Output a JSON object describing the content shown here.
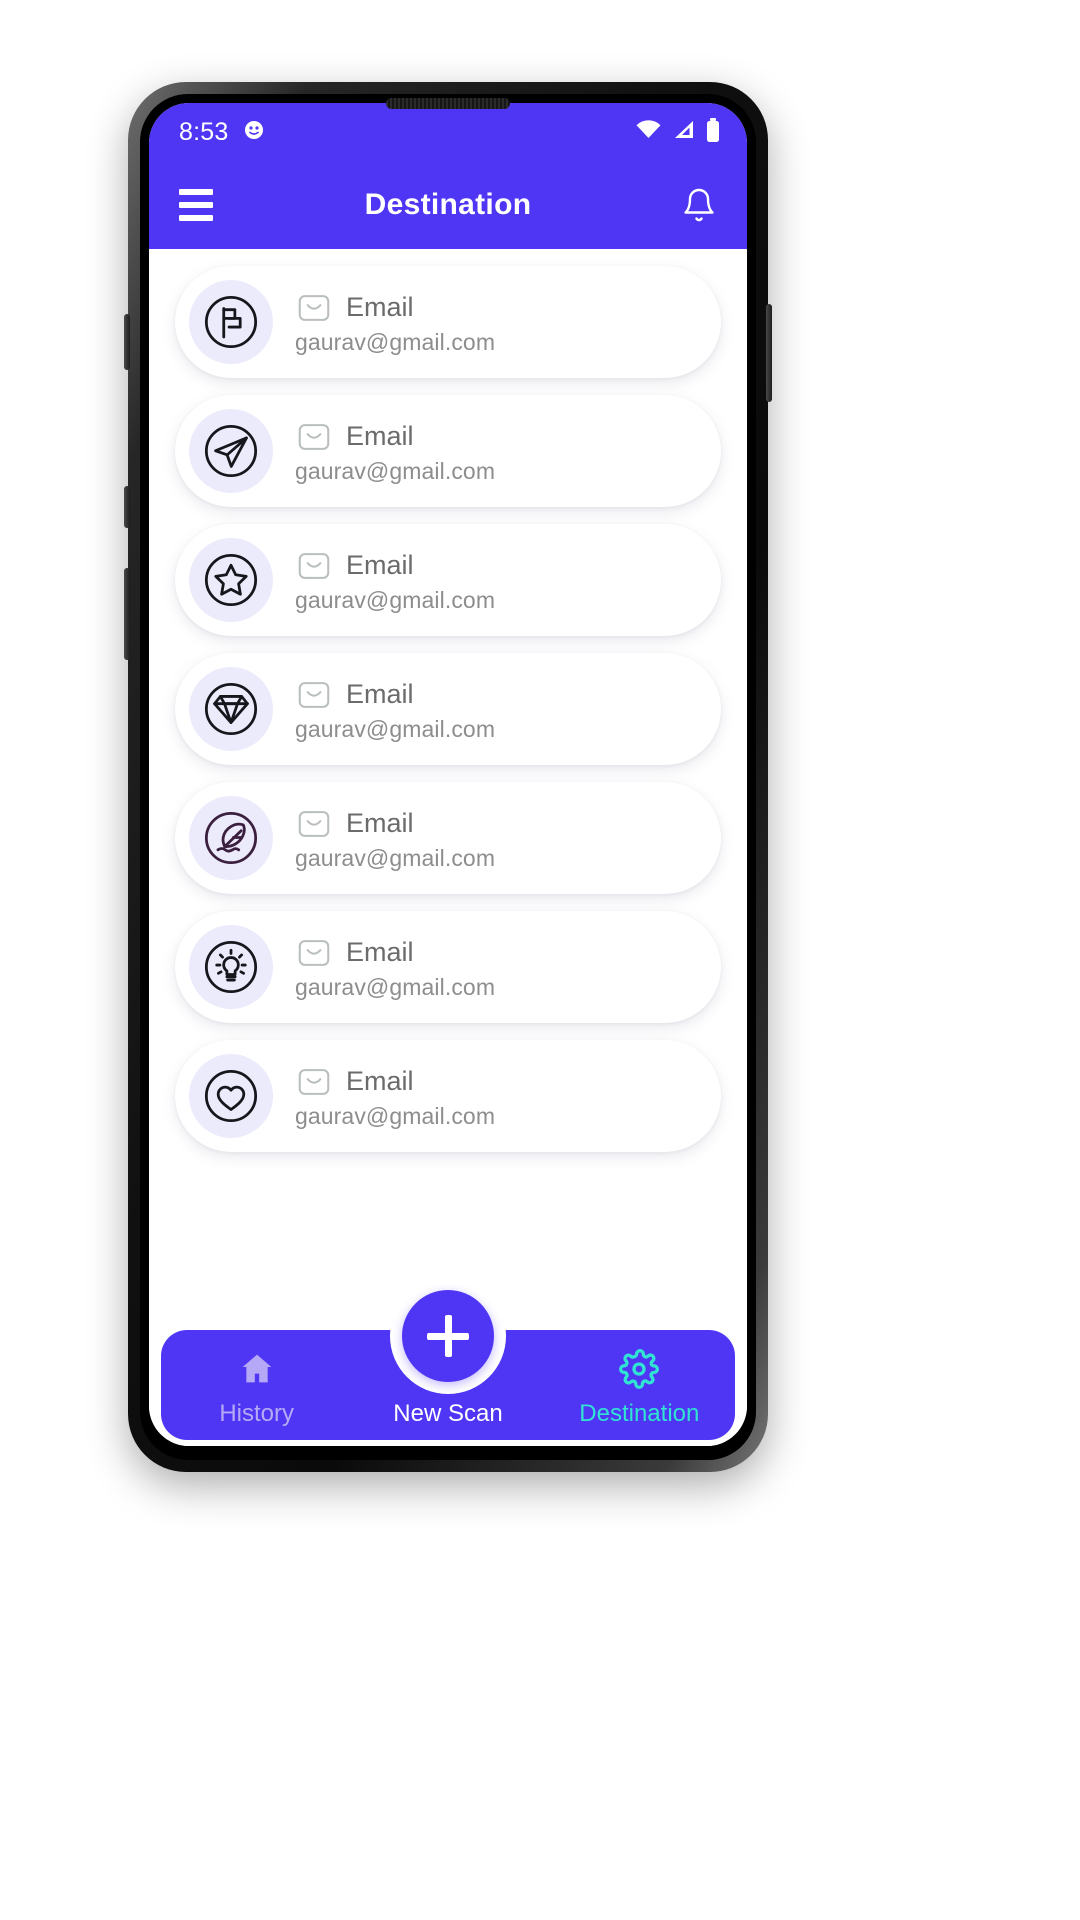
{
  "status_bar": {
    "time": "8:53",
    "icons": [
      "face-icon",
      "wifi-icon",
      "cellular-signal-icon",
      "battery-icon"
    ]
  },
  "app_bar": {
    "title": "Destination",
    "menu_icon": "hamburger-menu-icon",
    "notification_icon": "bell-icon"
  },
  "theme": {
    "primary": "#4f36f5",
    "accent": "#30e3d2",
    "avatar_bg": "#ecebfb",
    "card_bg": "#ffffff",
    "muted_label": "#b5a9f7"
  },
  "list": {
    "items": [
      {
        "icon": "flag-icon",
        "label": "Email",
        "value": "gaurav@gmail.com"
      },
      {
        "icon": "send-icon",
        "label": "Email",
        "value": "gaurav@gmail.com"
      },
      {
        "icon": "star-icon",
        "label": "Email",
        "value": "gaurav@gmail.com"
      },
      {
        "icon": "diamond-icon",
        "label": "Email",
        "value": "gaurav@gmail.com"
      },
      {
        "icon": "feather-icon",
        "label": "Email",
        "value": "gaurav@gmail.com"
      },
      {
        "icon": "lightbulb-icon",
        "label": "Email",
        "value": "gaurav@gmail.com"
      },
      {
        "icon": "heart-icon",
        "label": "Email",
        "value": "gaurav@gmail.com"
      }
    ]
  },
  "bottom_nav": {
    "items": [
      {
        "label": "History",
        "icon": "home-icon",
        "active": false
      },
      {
        "label": "New Scan",
        "icon": "plus-icon",
        "active": false
      },
      {
        "label": "Destination",
        "icon": "gear-icon",
        "active": true
      }
    ],
    "fab_icon": "plus-icon"
  }
}
